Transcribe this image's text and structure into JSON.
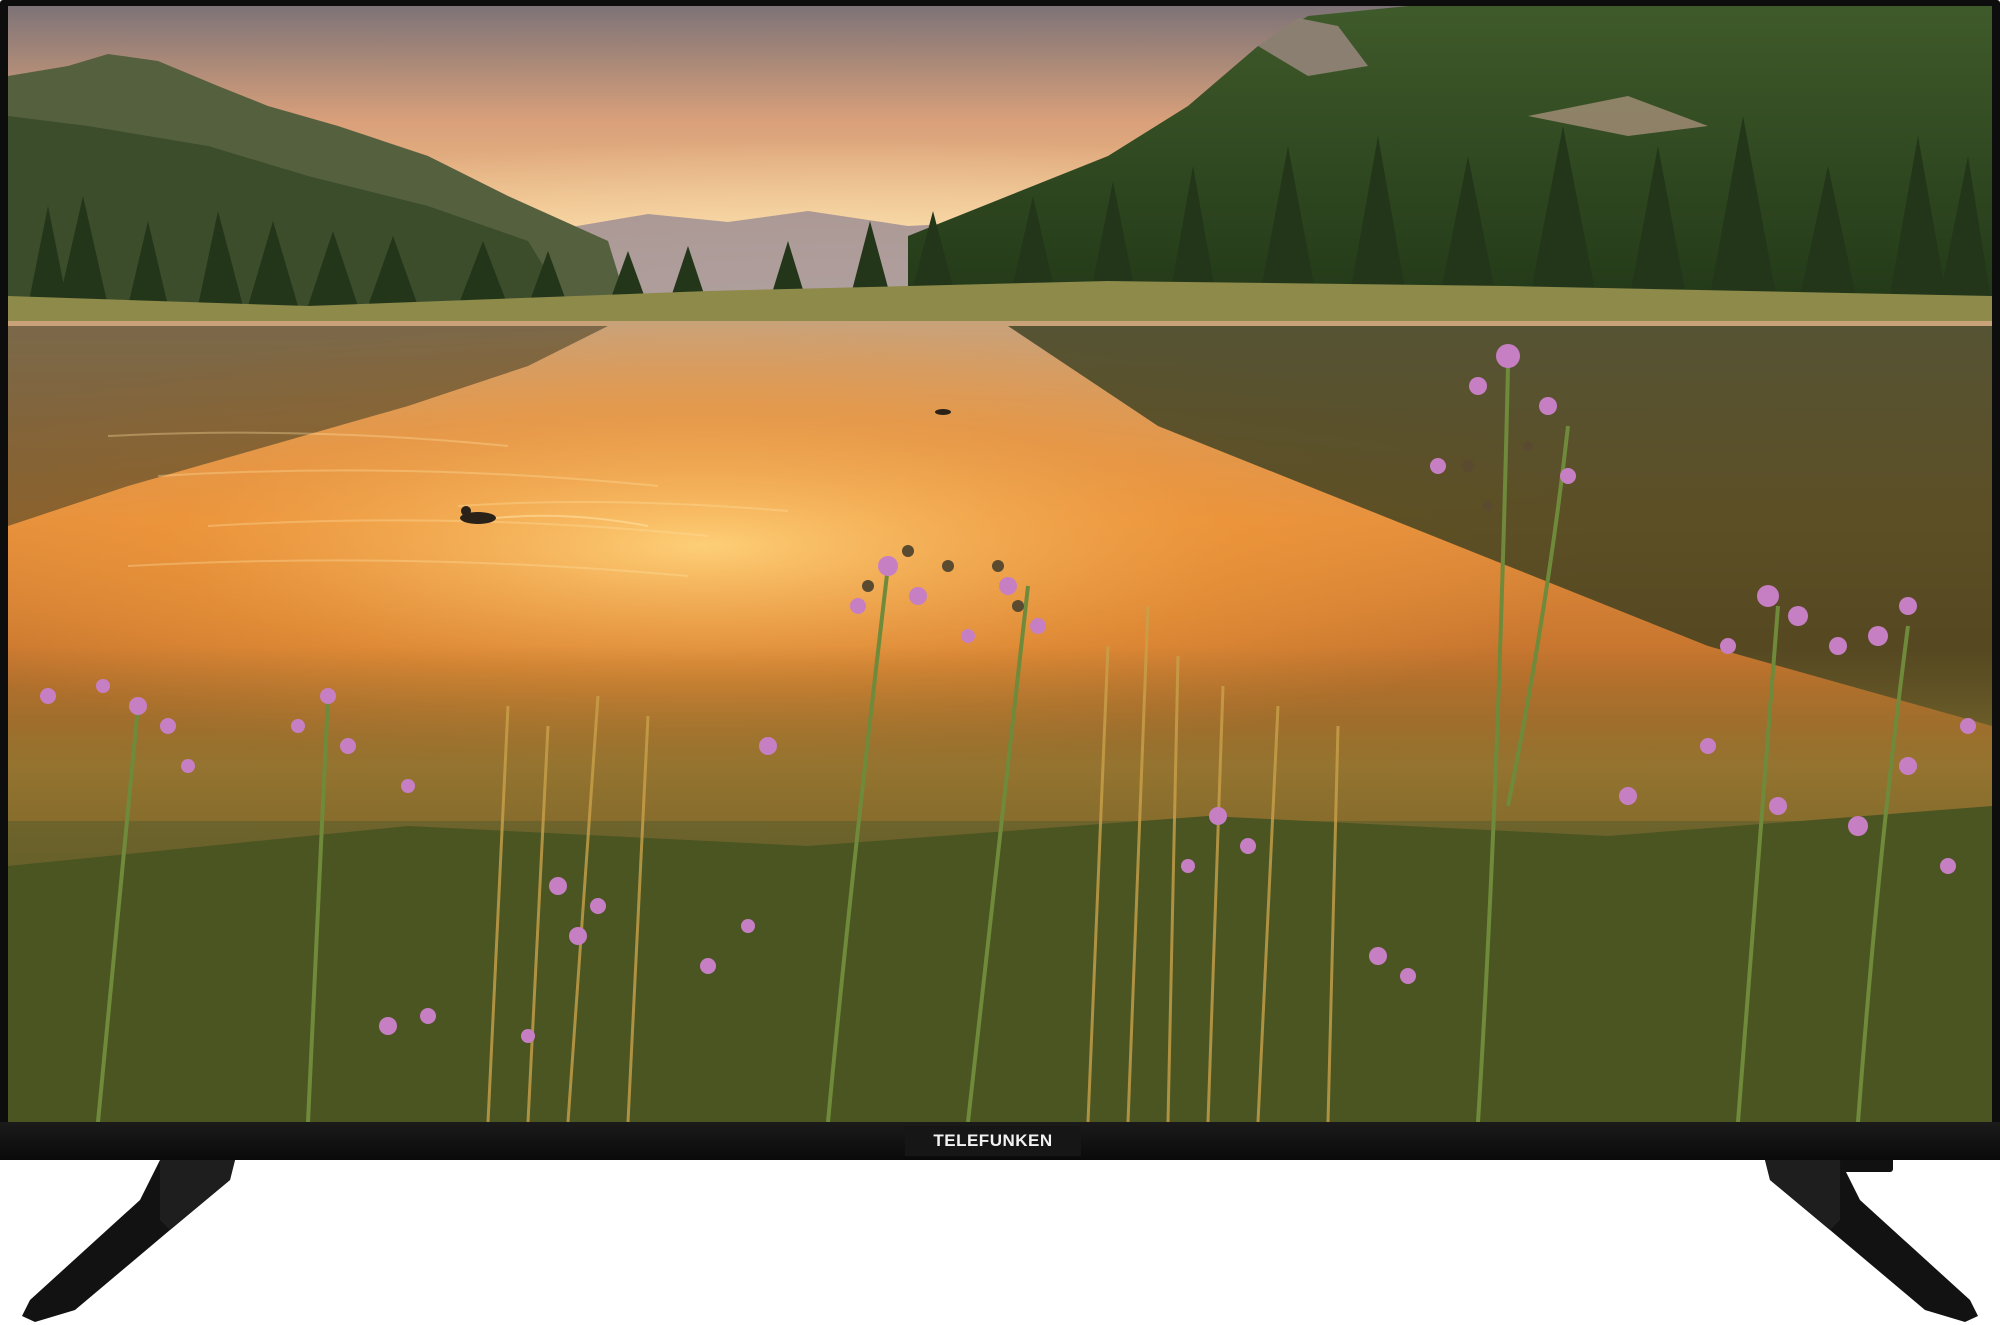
{
  "device": {
    "brand": "TELEFUNKEN",
    "brand_color": "#f2f2f2",
    "bezel_color": "#0d0d0d"
  },
  "screen": {
    "content": "lake-landscape-image",
    "palette": {
      "sky_top": "#8a7f86",
      "sky_glow": "#f7c27a",
      "water_glow": "#f59a3a",
      "forest": "#2f4a22",
      "flowers": "#c77fc4"
    }
  }
}
